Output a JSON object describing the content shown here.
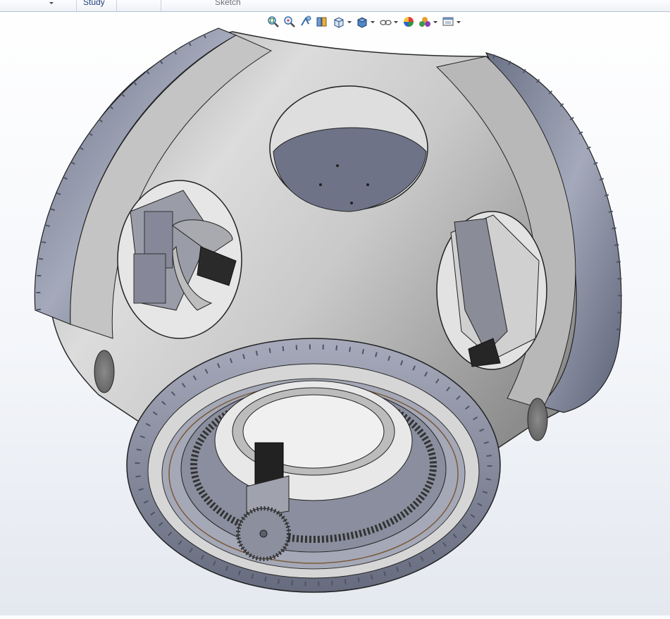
{
  "command_manager": {
    "tabs": [
      {
        "label": "Study"
      },
      {
        "label": "Sketch"
      }
    ]
  },
  "view_toolbar": {
    "buttons": [
      {
        "name": "zoom-to-fit",
        "icon": "zoom-to-fit-icon"
      },
      {
        "name": "zoom-to-area",
        "icon": "zoom-to-area-icon"
      },
      {
        "name": "previous-view",
        "icon": "previous-view-icon"
      },
      {
        "name": "section-view",
        "icon": "section-view-icon"
      },
      {
        "name": "view-orientation",
        "icon": "view-orientation-icon"
      },
      {
        "name": "display-style",
        "icon": "display-style-icon"
      },
      {
        "name": "hide-show-items",
        "icon": "hide-show-items-icon"
      },
      {
        "name": "edit-appearance",
        "icon": "edit-appearance-icon"
      },
      {
        "name": "apply-scene",
        "icon": "apply-scene-icon"
      },
      {
        "name": "view-settings",
        "icon": "view-settings-icon"
      }
    ]
  },
  "model": {
    "description_icon": "hub-assembly-3d-model",
    "colors": {
      "casting": "#cfcfcf",
      "flange": "#7e8499",
      "gear": "#8f93a3",
      "motor": "#1e1e1e",
      "background_top": "#ffffff",
      "background_bottom": "#e4e8ef"
    }
  }
}
